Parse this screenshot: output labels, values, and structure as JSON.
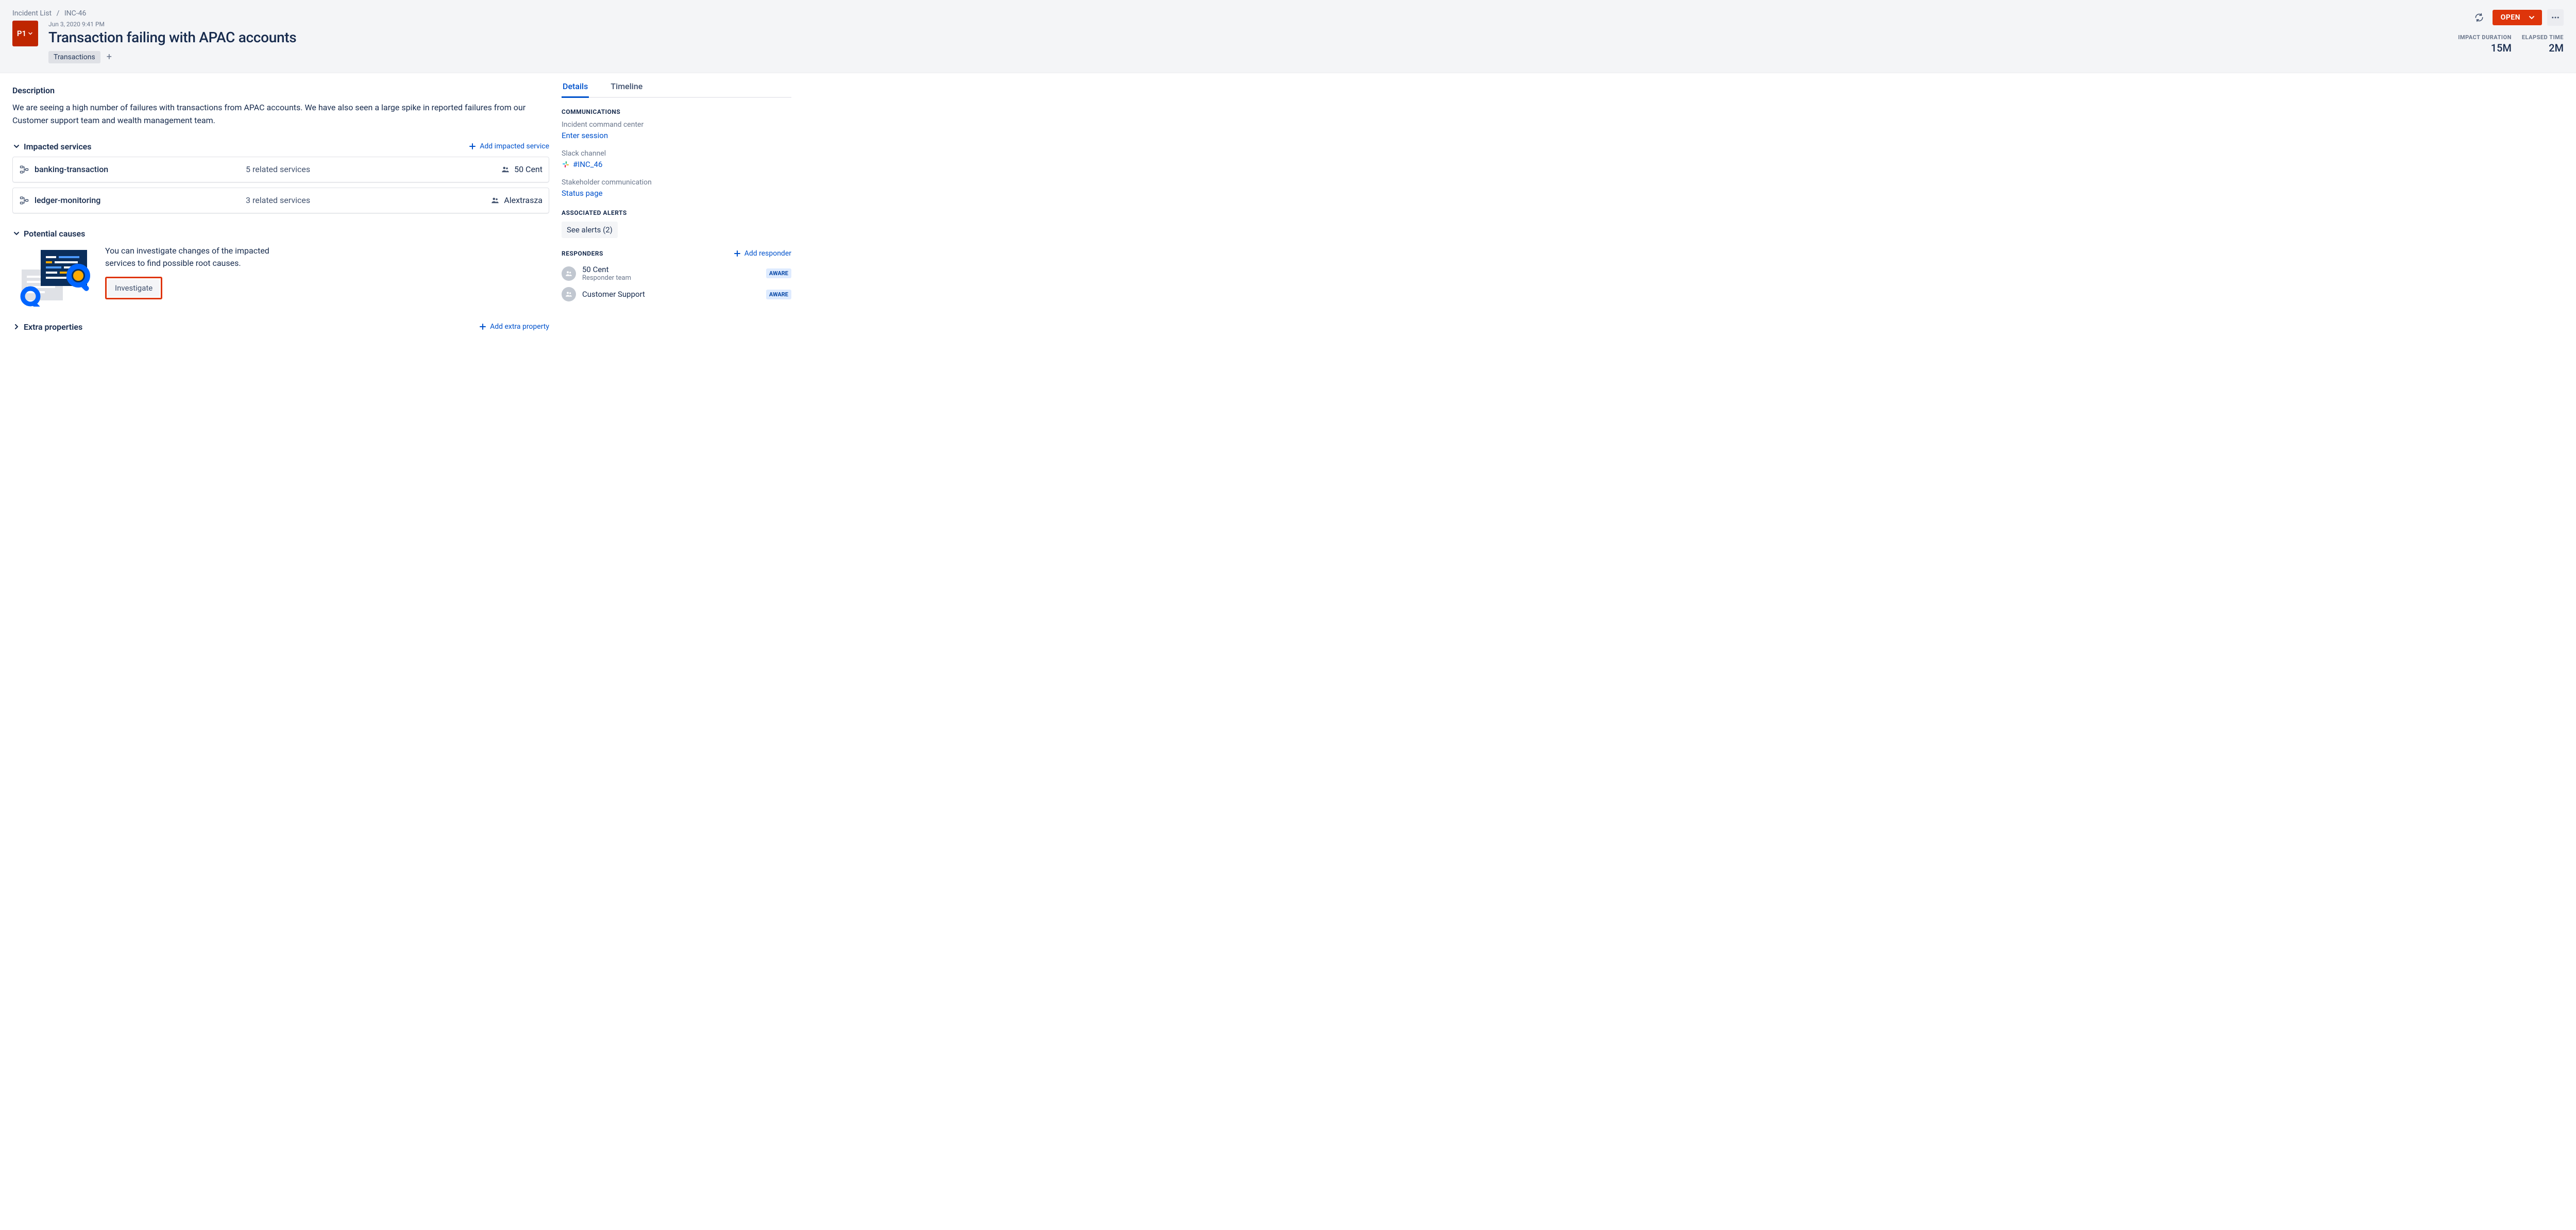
{
  "breadcrumbs": {
    "root": "Incident List",
    "current": "INC-46"
  },
  "priority": "P1",
  "timestamp": "Jun 3, 2020 9:41 PM",
  "title": "Transaction failing with APAC accounts",
  "tags": [
    "Transactions"
  ],
  "status": "OPEN",
  "stats": {
    "impact_label": "IMPACT DURATION",
    "impact_value": "15M",
    "elapsed_label": "ELAPSED TIME",
    "elapsed_value": "2M"
  },
  "description": {
    "heading": "Description",
    "body": "We are seeing a high number of failures with transactions from APAC accounts. We have also seen a large spike in reported failures from our Customer support team and wealth management team."
  },
  "impacted": {
    "heading": "Impacted services",
    "add_label": "Add impacted service",
    "services": [
      {
        "name": "banking-transaction",
        "related": "5 related services",
        "owner": "50 Cent"
      },
      {
        "name": "ledger-monitoring",
        "related": "3 related services",
        "owner": "Alextrasza"
      }
    ]
  },
  "potential": {
    "heading": "Potential causes",
    "text": "You can investigate changes of the impacted services to find possible root causes.",
    "button": "Investigate"
  },
  "extra": {
    "heading": "Extra properties",
    "add_label": "Add extra property"
  },
  "sidebar": {
    "tabs": {
      "details": "Details",
      "timeline": "Timeline"
    },
    "communications": {
      "heading": "COMMUNICATIONS",
      "icc_label": "Incident command center",
      "icc_link": "Enter session",
      "slack_label": "Slack channel",
      "slack_link": "#INC_46",
      "stake_label": "Stakeholder communication",
      "stake_link": "Status page"
    },
    "alerts": {
      "heading": "ASSOCIATED ALERTS",
      "chip": "See alerts (2)"
    },
    "responders": {
      "heading": "RESPONDERS",
      "add_label": "Add responder",
      "items": [
        {
          "name": "50 Cent",
          "sub": "Responder team",
          "badge": "AWARE"
        },
        {
          "name": "Customer Support",
          "sub": "",
          "badge": "AWARE"
        }
      ]
    }
  }
}
